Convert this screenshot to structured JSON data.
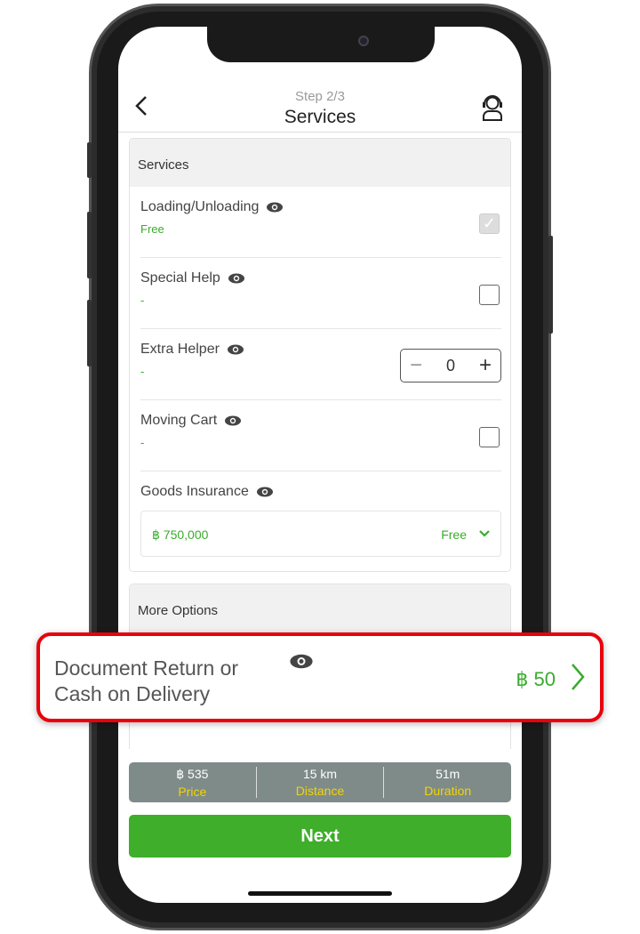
{
  "header": {
    "step": "Step 2/3",
    "title": "Services",
    "back_icon": "chevron-left",
    "support_icon": "agent-headset"
  },
  "services": {
    "section_title": "Services",
    "items": [
      {
        "label": "Loading/Unloading",
        "price": "Free",
        "control": "checkbox",
        "checked": true,
        "disabled": true
      },
      {
        "label": "Special Help",
        "price": "-",
        "control": "checkbox",
        "checked": false
      },
      {
        "label": "Extra Helper",
        "price": "-",
        "control": "stepper",
        "value": "0"
      },
      {
        "label": "Moving Cart",
        "price": "-",
        "control": "checkbox",
        "checked": false
      }
    ],
    "insurance": {
      "label": "Goods Insurance",
      "value": "฿ 750,000",
      "price": "Free"
    }
  },
  "more_options": {
    "section_title": "More Options"
  },
  "callout": {
    "label": "Document Return or Cash on Delivery",
    "line1": "Document Return or",
    "line2": "Cash on Delivery",
    "price": "฿ 50"
  },
  "summary": [
    {
      "value": "฿ 535",
      "label": "Price"
    },
    {
      "value": "15 km",
      "label": "Distance"
    },
    {
      "value": "51m",
      "label": "Duration"
    }
  ],
  "next_label": "Next",
  "colors": {
    "accent": "#3fae2a",
    "highlight": "#e8000b",
    "summary_bg": "#7f8b89",
    "summary_label": "#f4d400"
  }
}
